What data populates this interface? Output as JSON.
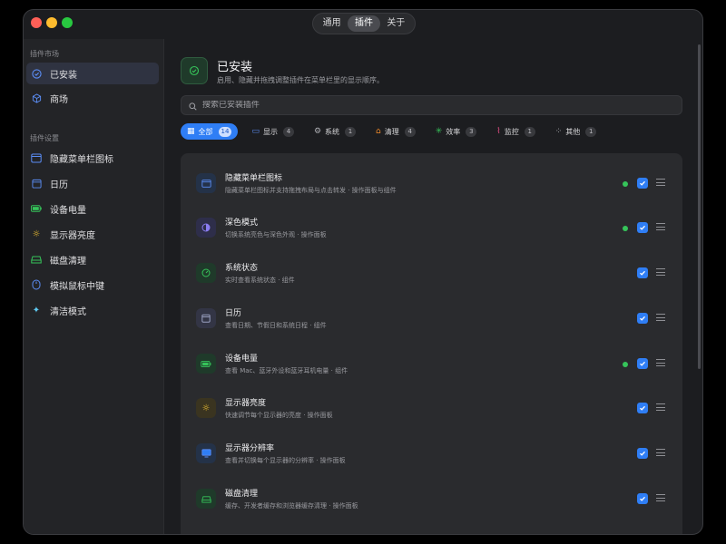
{
  "titlebar": {
    "tabs": [
      {
        "label": "通用"
      },
      {
        "label": "插件"
      },
      {
        "label": "关于"
      }
    ]
  },
  "sidebar": {
    "section_market": "插件市场",
    "market_items": [
      {
        "label": "已安装",
        "icon": "check-circle-icon"
      },
      {
        "label": "商场",
        "icon": "cube-icon"
      }
    ],
    "section_settings": "插件设置",
    "setting_items": [
      {
        "label": "隐藏菜单栏图标",
        "icon": "menubar-icon"
      },
      {
        "label": "日历",
        "icon": "calendar-icon"
      },
      {
        "label": "设备电量",
        "icon": "battery-icon"
      },
      {
        "label": "显示器亮度",
        "icon": "sun-icon"
      },
      {
        "label": "磁盘清理",
        "icon": "drive-icon"
      },
      {
        "label": "模拟鼠标中键",
        "icon": "mouse-icon"
      },
      {
        "label": "清洁模式",
        "icon": "sparkle-icon"
      }
    ]
  },
  "main": {
    "title": "已安装",
    "subtitle": "启用、隐藏并拖拽调整插件在菜单栏里的显示顺序。",
    "search_placeholder": "搜索已安装插件",
    "filters": [
      {
        "label": "全部",
        "count": "14",
        "icon": "grid-icon"
      },
      {
        "label": "显示",
        "count": "4",
        "icon": "monitor-icon"
      },
      {
        "label": "系统",
        "count": "1",
        "icon": "gear-icon"
      },
      {
        "label": "清理",
        "count": "4",
        "icon": "broom-icon"
      },
      {
        "label": "效率",
        "count": "3",
        "icon": "bolt-icon"
      },
      {
        "label": "监控",
        "count": "1",
        "icon": "chart-icon"
      },
      {
        "label": "其他",
        "count": "1",
        "icon": "dots-icon"
      }
    ],
    "plugins": [
      {
        "title": "隐藏菜单栏图标",
        "desc": "隐藏菜单栏图标并支持拖拽布局与点击转发 · 操作面板与组件",
        "dot": true,
        "checked": true
      },
      {
        "title": "深色模式",
        "desc": "切换系统亮色与深色外观 · 操作面板",
        "dot": true,
        "checked": true
      },
      {
        "title": "系统状态",
        "desc": "实时查看系统状态 · 组件",
        "dot": false,
        "checked": true
      },
      {
        "title": "日历",
        "desc": "查看日期、节假日和系统日程 · 组件",
        "dot": false,
        "checked": true
      },
      {
        "title": "设备电量",
        "desc": "查看 Mac、蓝牙外设和蓝牙耳机电量 · 组件",
        "dot": true,
        "checked": true
      },
      {
        "title": "显示器亮度",
        "desc": "快速调节每个显示器的亮度 · 操作面板",
        "dot": false,
        "checked": true
      },
      {
        "title": "显示器分辨率",
        "desc": "查看并切换每个显示器的分辨率 · 操作面板",
        "dot": false,
        "checked": true
      },
      {
        "title": "磁盘清理",
        "desc": "缓存、开发者缓存和浏览器缓存清理 · 操作面板",
        "dot": false,
        "checked": true
      }
    ]
  },
  "colors": {
    "accent": "#2f7ef5",
    "status_dot": "#36c45a"
  }
}
